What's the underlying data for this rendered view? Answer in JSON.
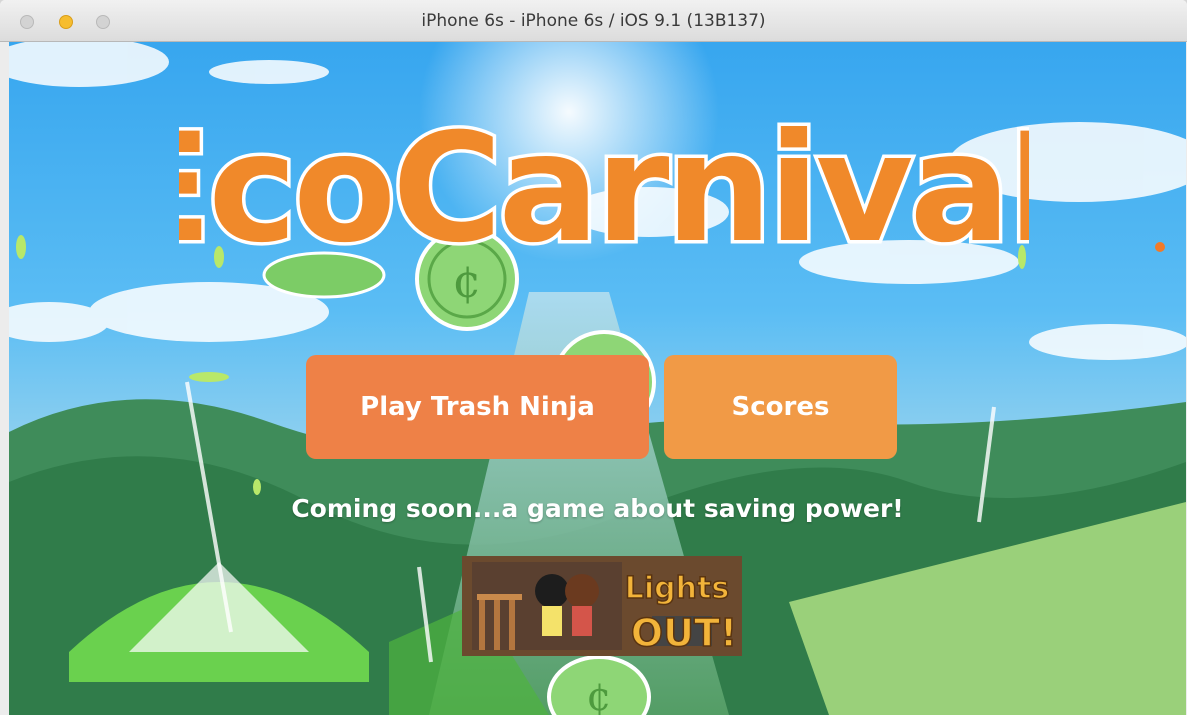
{
  "window": {
    "title": "iPhone 6s - iPhone 6s / iOS 9.1 (13B137)"
  },
  "logo": {
    "text": "EcoCarnivaL",
    "colors": {
      "fill": "#f0892a",
      "outline": "#ffffff"
    }
  },
  "buttons": {
    "play_label": "Play Trash Ninja",
    "scores_label": "Scores"
  },
  "announcement": {
    "text": "Coming soon...a game about saving power!"
  },
  "banner": {
    "title": "Lights OUT!"
  },
  "colors": {
    "sky": "#37a6ef",
    "play_button": "#ee8147",
    "scores_button": "#f19a46",
    "coin": "#8ed676",
    "grass": "#6ad14e"
  }
}
